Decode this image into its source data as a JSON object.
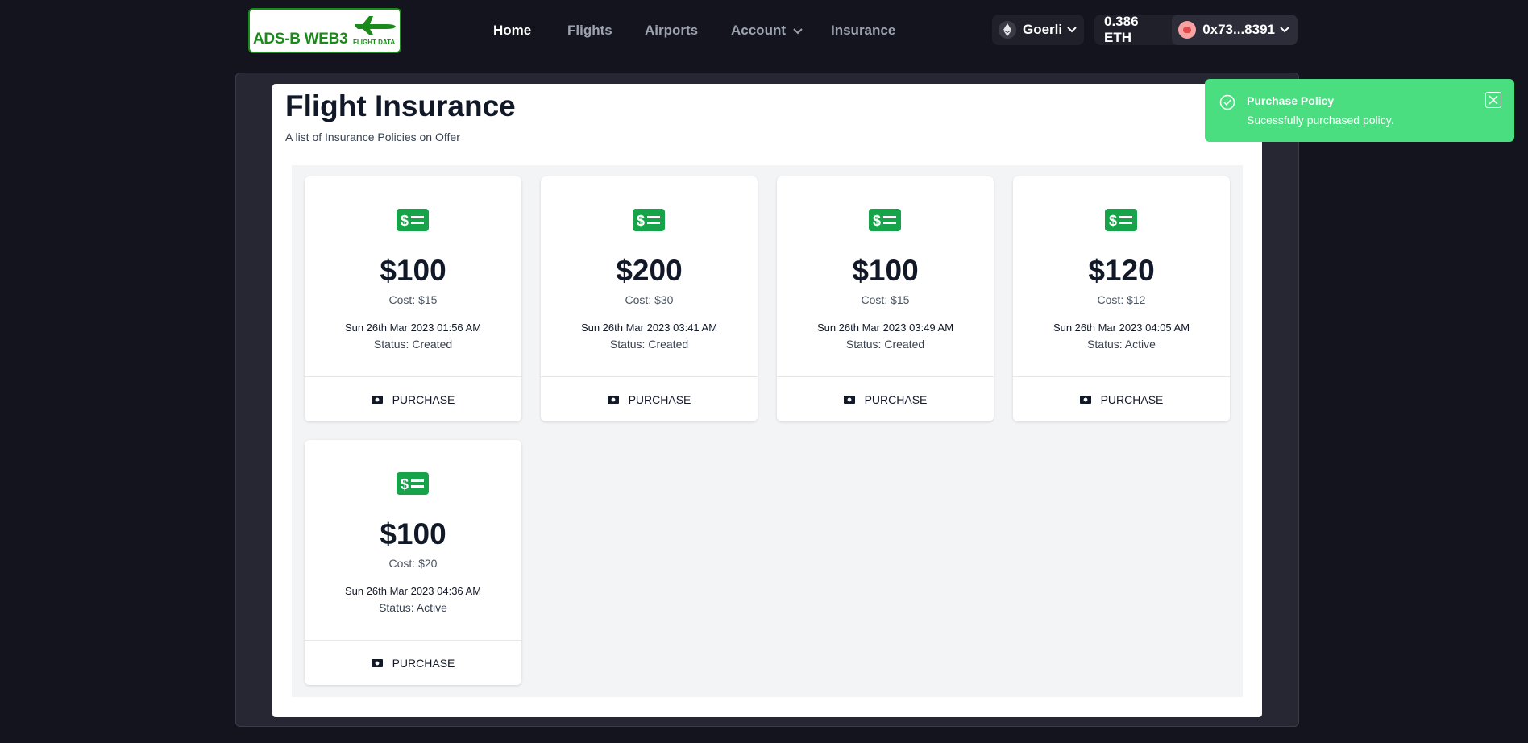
{
  "logo": {
    "main": "ADS-B WEB3",
    "sub": "FLIGHT DATA"
  },
  "nav": [
    {
      "label": "Home",
      "active": true
    },
    {
      "label": "Flights"
    },
    {
      "label": "Airports"
    },
    {
      "label": "Account",
      "has_dropdown": true
    },
    {
      "label": "Insurance"
    }
  ],
  "network": {
    "label": "Goerli",
    "icon": "ethereum-icon"
  },
  "wallet": {
    "balance": "0.386 ETH",
    "address": "0x73...8391"
  },
  "page": {
    "title": "Flight Insurance",
    "subtitle": "A list of Insurance Policies on Offer"
  },
  "policies": [
    {
      "amount": "$100",
      "cost": "Cost: $15",
      "date": "Sun 26th Mar 2023 01:56 AM",
      "status": "Status: Created",
      "action": "PURCHASE"
    },
    {
      "amount": "$200",
      "cost": "Cost: $30",
      "date": "Sun 26th Mar 2023 03:41 AM",
      "status": "Status: Created",
      "action": "PURCHASE"
    },
    {
      "amount": "$100",
      "cost": "Cost: $15",
      "date": "Sun 26th Mar 2023 03:49 AM",
      "status": "Status: Created",
      "action": "PURCHASE"
    },
    {
      "amount": "$120",
      "cost": "Cost: $12",
      "date": "Sun 26th Mar 2023 04:05 AM",
      "status": "Status: Active",
      "action": "PURCHASE"
    },
    {
      "amount": "$100",
      "cost": "Cost: $20",
      "date": "Sun 26th Mar 2023 04:36 AM",
      "status": "Status: Active",
      "action": "PURCHASE"
    }
  ],
  "toast": {
    "title": "Purchase Policy",
    "message": "Sucessfully purchased policy."
  },
  "colors": {
    "accent_green": "#16a34a",
    "toast_green": "#4ade80",
    "background": "#13141e"
  }
}
